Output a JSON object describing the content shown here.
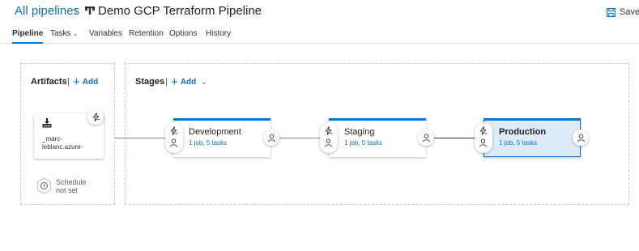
{
  "header": {
    "breadcrumb": "All pipelines",
    "title": "Demo GCP Terraform Pipeline",
    "save_label": "Save"
  },
  "tabs": [
    {
      "label": "Pipeline",
      "active": true
    },
    {
      "label": "Tasks",
      "has_dropdown": true
    },
    {
      "label": "Variables"
    },
    {
      "label": "Retention"
    },
    {
      "label": "Options"
    },
    {
      "label": "History"
    }
  ],
  "artifacts": {
    "title": "Artifacts",
    "separator": "|",
    "add_label": "Add",
    "items": [
      {
        "name_line1": "_marc-",
        "name_line2": "leblanc.azure-",
        "icon": "build-artifact-icon"
      }
    ],
    "schedule": {
      "line1": "Schedule",
      "line2": "not set"
    }
  },
  "stages_panel": {
    "title": "Stages",
    "separator": "|",
    "add_label": "Add"
  },
  "stages": [
    {
      "name": "Development",
      "summary": "1 job, 5 tasks",
      "selected": false
    },
    {
      "name": "Staging",
      "summary": "1 job, 5 tasks",
      "selected": false
    },
    {
      "name": "Production",
      "summary": "1 job, 5 tasks",
      "selected": true
    }
  ],
  "colors": {
    "accent": "#0078d4",
    "link": "#106ebe",
    "selected_stage_bg": "#deecf9",
    "border": "#c8c6c4"
  }
}
